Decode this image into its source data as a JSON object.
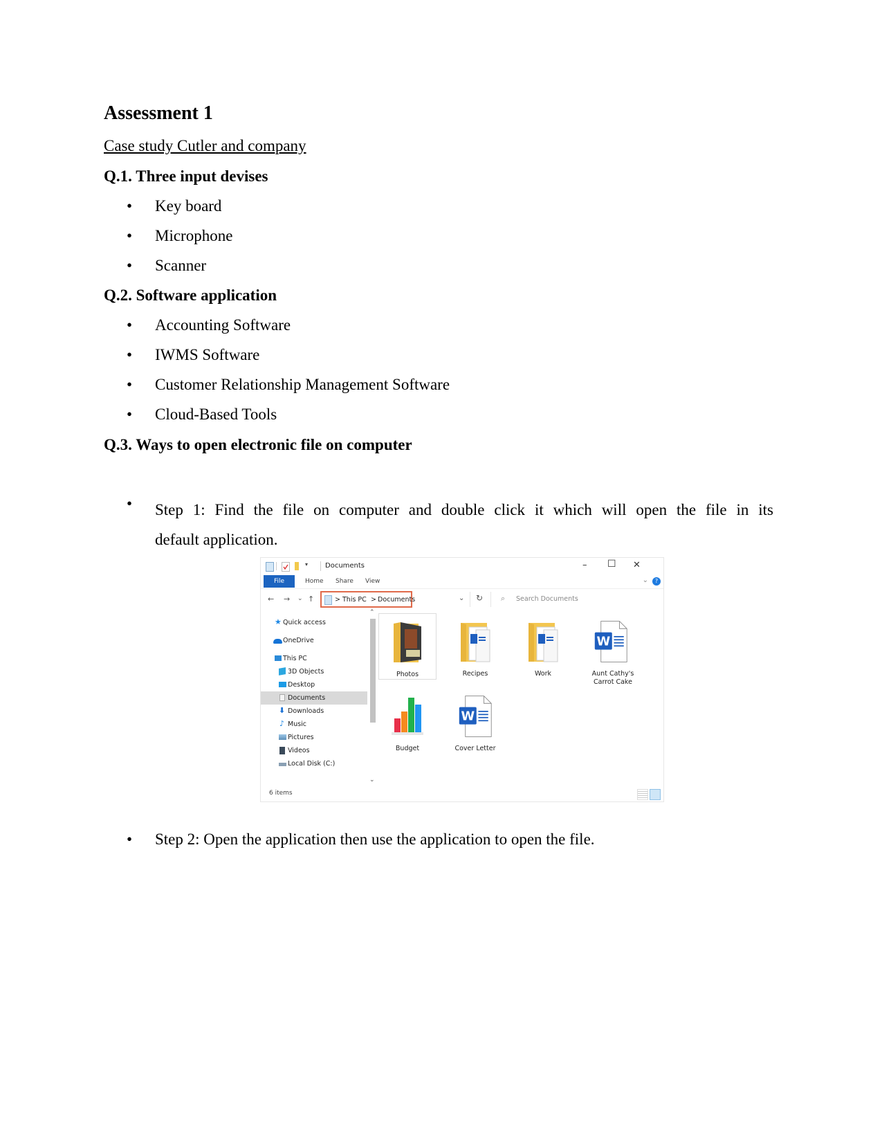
{
  "document": {
    "title": "Assessment 1",
    "subtitle": "Case study Cutler and company ",
    "bullet_glyph": "•",
    "questions": [
      {
        "heading": "Q.1.  Three input devises",
        "items": [
          "Key board",
          "Microphone",
          "Scanner"
        ]
      },
      {
        "heading": "Q.2.  Software application",
        "items": [
          "Accounting Software",
          "IWMS Software",
          "Customer Relationship Management Software",
          "Cloud-Based Tools"
        ]
      },
      {
        "heading": "Q.3. Ways to open electronic file on computer",
        "steps": [
          {
            "line1": " Step 1: Find the file on computer and double click it which will open the file in its",
            "line2": "default application."
          },
          {
            "text": "Step 2: Open the application then use the application to open the file."
          }
        ]
      }
    ]
  },
  "explorer": {
    "window_title": "Documents",
    "window_controls": {
      "minimize": "–",
      "maximize": "☐",
      "close": "✕"
    },
    "ribbon_tabs": [
      "File",
      "Home",
      "Share",
      "View"
    ],
    "ribbon_collapse": "⌄",
    "help": "?",
    "nav": {
      "back": "←",
      "forward": "→",
      "recent": "⌄",
      "up": "↑",
      "refresh": "↻",
      "dropdown": "⌄"
    },
    "breadcrumb": [
      "This PC",
      "Documents"
    ],
    "breadcrumb_sep": ">",
    "search": {
      "icon": "⌕",
      "placeholder": "Search Documents"
    },
    "accent_color": "#1c64c0",
    "highlight_color": "#e06a4a",
    "sidebar": [
      {
        "label": "Quick access",
        "icon": "star-icon",
        "level": 0
      },
      {
        "label": "OneDrive",
        "icon": "cloud-icon",
        "level": 0
      },
      {
        "label": "This PC",
        "icon": "computer-icon",
        "level": 0
      },
      {
        "label": "3D Objects",
        "icon": "cube-icon",
        "level": 1
      },
      {
        "label": "Desktop",
        "icon": "desktop-icon",
        "level": 1
      },
      {
        "label": "Documents",
        "icon": "document-icon",
        "level": 1,
        "selected": true
      },
      {
        "label": "Downloads",
        "icon": "download-arrow-icon",
        "level": 1
      },
      {
        "label": "Music",
        "icon": "music-note-icon",
        "level": 1
      },
      {
        "label": "Pictures",
        "icon": "picture-icon",
        "level": 1
      },
      {
        "label": "Videos",
        "icon": "film-icon",
        "level": 1
      },
      {
        "label": "Local Disk (C:)",
        "icon": "drive-icon",
        "level": 1
      }
    ],
    "files": [
      {
        "name": "Photos",
        "type": "folder-photos",
        "selected": true
      },
      {
        "name": "Recipes",
        "type": "folder-docs"
      },
      {
        "name": "Work",
        "type": "folder-docs"
      },
      {
        "name": "Aunt Cathy's Carrot Cake",
        "type": "word-doc"
      },
      {
        "name": "Budget",
        "type": "spreadsheet-chart"
      },
      {
        "name": "Cover Letter",
        "type": "word-doc"
      }
    ],
    "status": "6 items",
    "scroll": {
      "up": "⌃",
      "down": "⌄"
    }
  }
}
